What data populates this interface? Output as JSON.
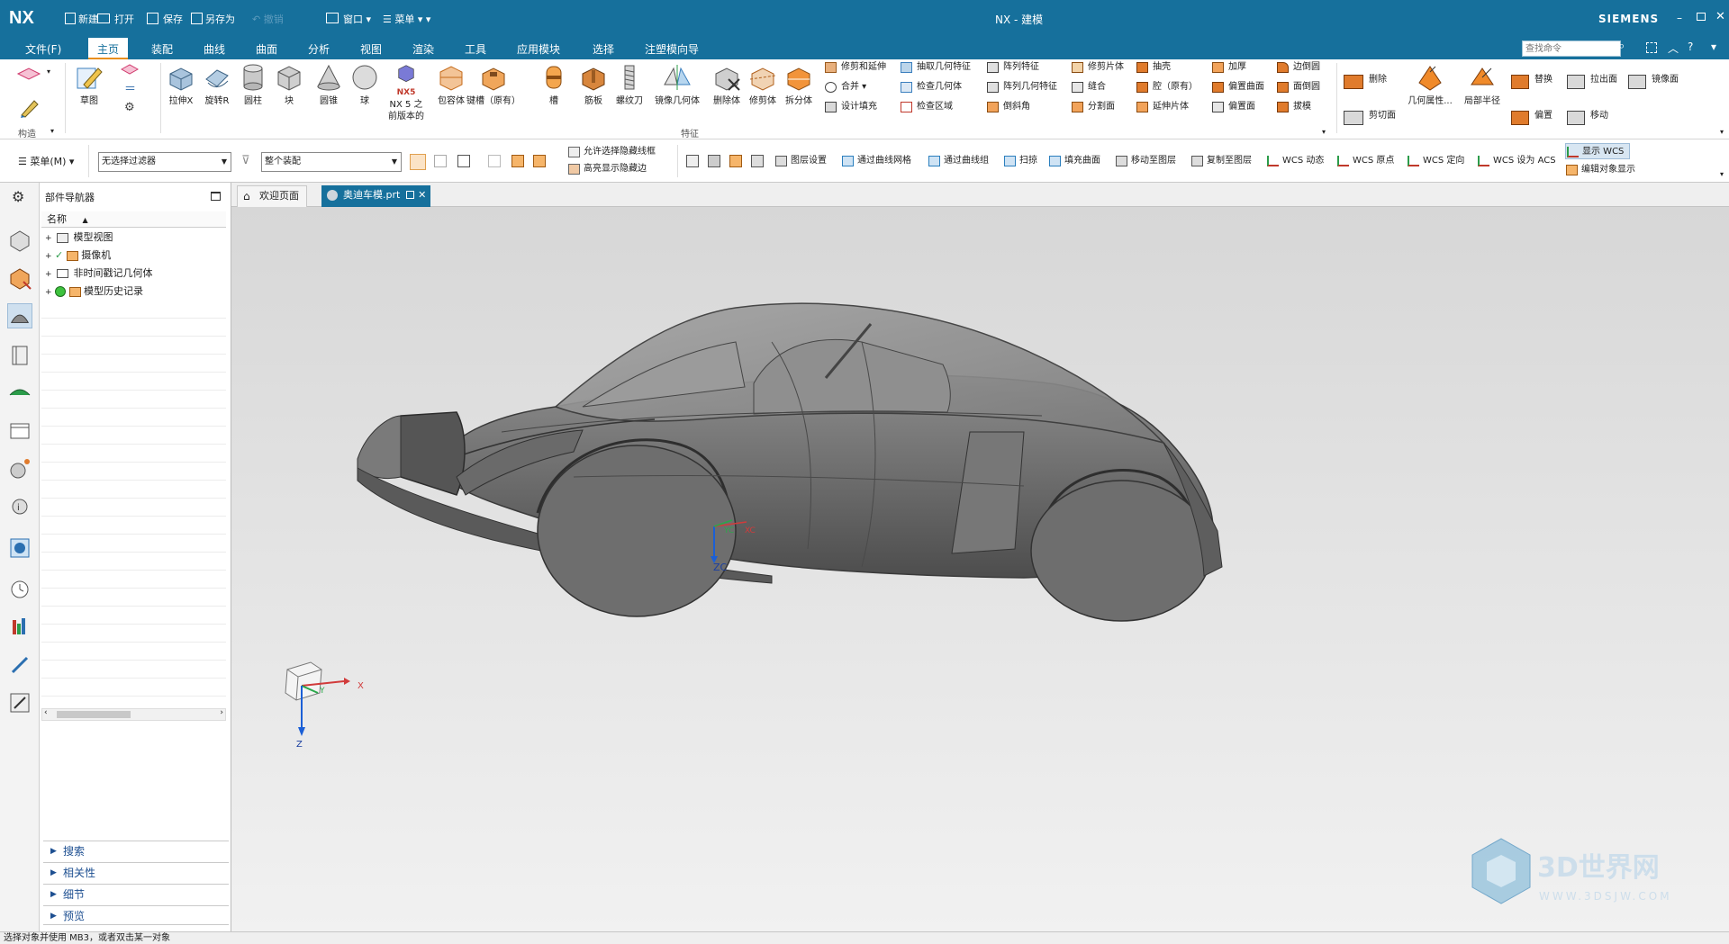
{
  "titlebar": {
    "logo": "NX",
    "quick_access": [
      "新建",
      "打开",
      "保存",
      "另存为",
      "撤销",
      "窗口",
      "菜单"
    ],
    "title": "NX - 建模",
    "brand": "SIEMENS",
    "window_controls": [
      "minimize-icon",
      "restore-icon",
      "close-icon"
    ]
  },
  "menubar": {
    "items": [
      "文件(F)",
      "主页",
      "装配",
      "曲线",
      "曲面",
      "分析",
      "视图",
      "渲染",
      "工具",
      "应用模块",
      "选择",
      "注塑模向导"
    ],
    "active": "主页",
    "search_placeholder": "查找命令"
  },
  "ribbon": {
    "construct_group_label": "构造",
    "sketch_label": "草图",
    "big_buttons": [
      "拉伸X",
      "旋转R",
      "圆柱",
      "块",
      "圆锥",
      "球",
      "NX 5 之前版本的",
      "包容体",
      "键槽（原有）",
      "槽",
      "筋板",
      "螺纹刀",
      "镜像几何体",
      "删除体",
      "修剪体",
      "拆分体"
    ],
    "nx5_badge": "NX5",
    "small_col1": [
      "修剪和延伸",
      "合并",
      "设计填充"
    ],
    "small_col2": [
      "抽取几何特征",
      "检查几何体",
      "检查区域"
    ],
    "small_col3": [
      "阵列特征",
      "阵列几何特征",
      "倒斜角"
    ],
    "small_col4": [
      "修剪片体",
      "缝合",
      "分割面"
    ],
    "small_col5": [
      "抽壳",
      "腔（原有）",
      "延伸片体"
    ],
    "small_col6": [
      "加厚",
      "偏置曲面",
      "偏置面"
    ],
    "small_col7": [
      "边倒圆",
      "面倒圆",
      "拔模"
    ],
    "feature_group_label": "特征",
    "sync_left": [
      "删除",
      "剪切面"
    ],
    "sync_big": [
      "几何属性...",
      "局部半径"
    ],
    "sync_right1": [
      "替换",
      "偏置"
    ],
    "sync_right2": [
      "拉出面",
      "移动"
    ],
    "sync_right3": [
      "镜像面"
    ]
  },
  "toolbar2": {
    "menu_label": "菜单(M)",
    "filter_value": "无选择过滤器",
    "assembly_value": "整个装配",
    "options": [
      "允许选择隐藏线框",
      "高亮显示隐藏边"
    ],
    "commands": [
      "图层设置",
      "通过曲线网格",
      "通过曲线组",
      "扫掠",
      "填充曲面",
      "移动至图层",
      "复制至图层",
      "WCS 动态",
      "WCS 原点",
      "WCS 定向",
      "WCS 设为 ACS"
    ],
    "right_top": "显示 WCS",
    "right_bottom": "编辑对象显示"
  },
  "navigator": {
    "title": "部件导航器",
    "column_header": "名称",
    "tree": [
      "模型视图",
      "摄像机",
      "非时间戳记几何体",
      "模型历史记录"
    ],
    "accordion": [
      "搜索",
      "相关性",
      "细节",
      "预览"
    ]
  },
  "tabs": [
    {
      "label": "欢迎页面"
    },
    {
      "label": "奥迪车模.prt"
    }
  ],
  "viewport": {
    "wcs_x": "XC",
    "wcs_y": "YC",
    "wcs_z": "ZC",
    "triad_x": "X",
    "triad_y": "Y",
    "triad_z": "Z",
    "watermark_text": "3D世界网",
    "watermark_url": "WWW.3DSJW.COM"
  },
  "status": {
    "text": "选择对象并使用 MB3，或者双击某一对象"
  },
  "colors": {
    "accent": "#16709c",
    "active_tab_underline": "#e98f1e",
    "car_body": "#6f6f6f"
  }
}
